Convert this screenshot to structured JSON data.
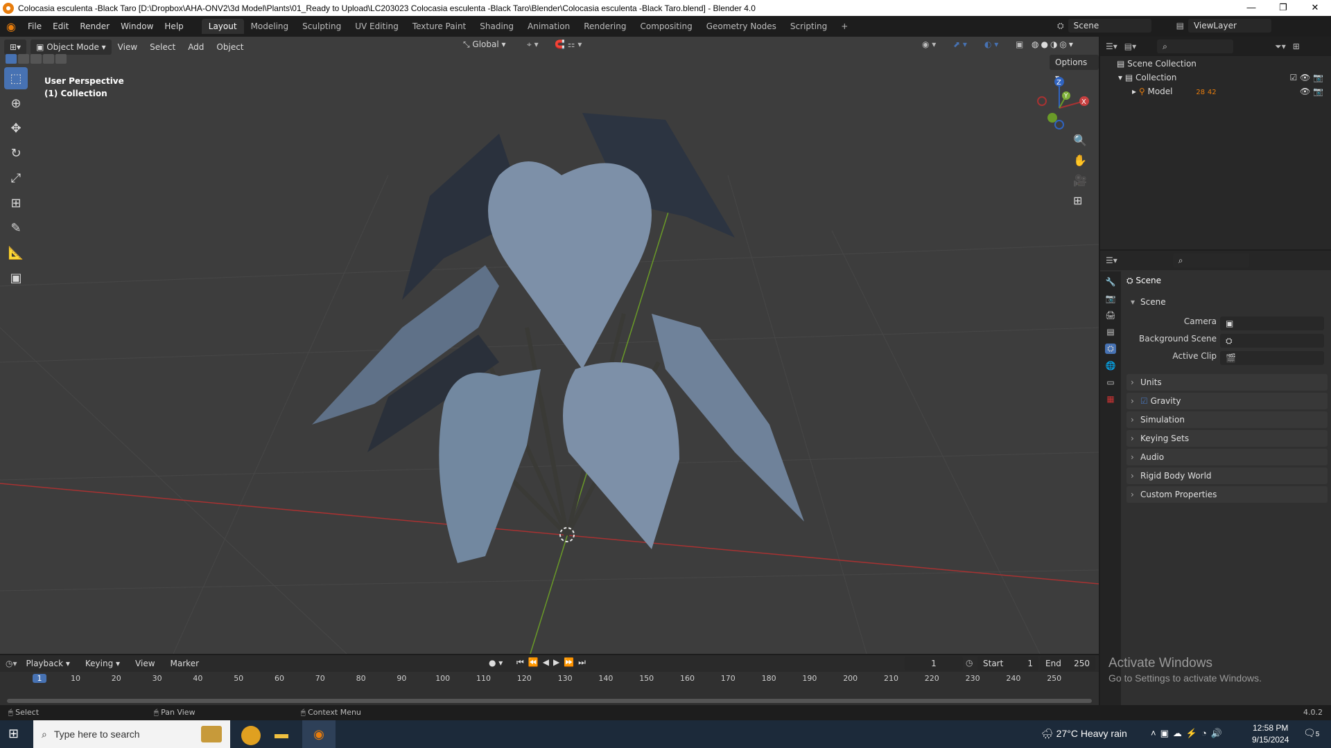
{
  "window": {
    "title": "Colocasia esculenta -Black Taro [D:\\Dropbox\\AHA-ONV2\\3d Model\\Plants\\01_Ready to Upload\\LC203023 Colocasia esculenta -Black Taro\\Blender\\Colocasia esculenta -Black Taro.blend] - Blender 4.0",
    "min": "—",
    "restore": "❐",
    "close": "✕"
  },
  "menu": [
    "File",
    "Edit",
    "Render",
    "Window",
    "Help"
  ],
  "workspaces": [
    "Layout",
    "Modeling",
    "Sculpting",
    "UV Editing",
    "Texture Paint",
    "Shading",
    "Animation",
    "Rendering",
    "Compositing",
    "Geometry Nodes",
    "Scripting"
  ],
  "add_workspace": "+",
  "scene_field": "Scene",
  "viewlayer_field": "ViewLayer",
  "viewport": {
    "mode": "Object Mode",
    "menus": [
      "View",
      "Select",
      "Add",
      "Object"
    ],
    "orientation": "Global",
    "options": "Options",
    "overlay_line1": "User Perspective",
    "overlay_line2": "(1) Collection",
    "gizmo_z": "Z",
    "gizmo_y": "Y",
    "gizmo_x": "X"
  },
  "outliner": {
    "scene_collection": "Scene Collection",
    "collection": "Collection",
    "model": "Model",
    "model_mods": "28",
    "model_data": "42"
  },
  "properties": {
    "context": "Scene",
    "section": "Scene",
    "camera_label": "Camera",
    "bg_scene_label": "Background Scene",
    "active_clip_label": "Active Clip",
    "panels": [
      "Units",
      "Gravity",
      "Simulation",
      "Keying Sets",
      "Audio",
      "Rigid Body World",
      "Custom Properties"
    ]
  },
  "timeline": {
    "menus": [
      "Playback",
      "Keying",
      "View",
      "Marker"
    ],
    "current_frame": "1",
    "start_label": "Start",
    "start": "1",
    "end_label": "End",
    "end": "250",
    "ticks": [
      "1",
      "10",
      "20",
      "30",
      "40",
      "50",
      "60",
      "70",
      "80",
      "90",
      "100",
      "110",
      "120",
      "130",
      "140",
      "150",
      "160",
      "170",
      "180",
      "190",
      "200",
      "210",
      "220",
      "230",
      "240",
      "250"
    ]
  },
  "activate_windows": {
    "title": "Activate Windows",
    "subtitle": "Go to Settings to activate Windows."
  },
  "statusbar": {
    "select": "Select",
    "pan": "Pan View",
    "context": "Context Menu",
    "version": "4.0.2"
  },
  "taskbar": {
    "search_placeholder": "Type here to search",
    "weather_temp": "27°C",
    "weather_desc": "Heavy rain",
    "time": "12:58 PM",
    "date": "9/15/2024",
    "notif_count": "5"
  },
  "colors": {
    "accent": "#4772b3",
    "x_axis": "#a83232",
    "y_axis": "#6a9a28",
    "z_axis": "#2f63c0",
    "leaf": "#7d90a8"
  }
}
